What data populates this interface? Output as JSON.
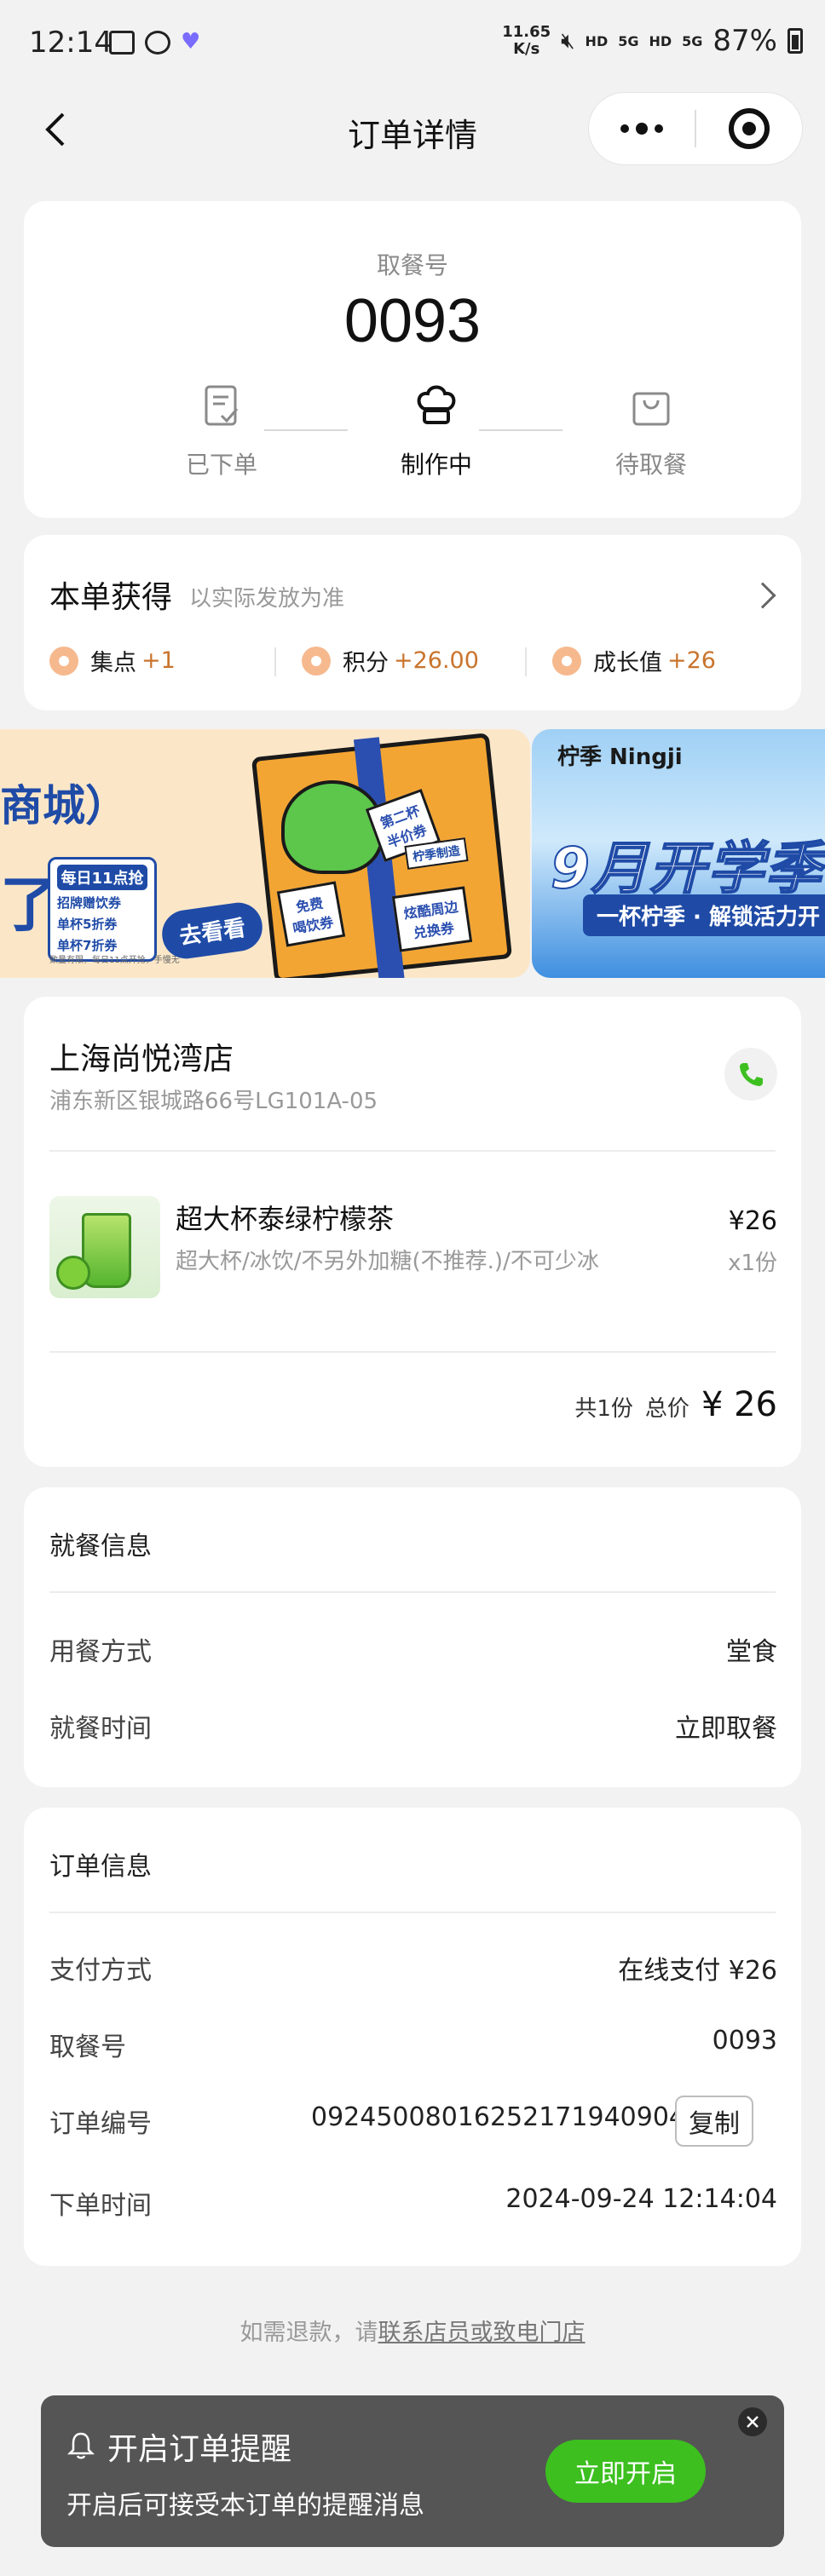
{
  "status_bar": {
    "time": "12:14",
    "net_speed": "11.65",
    "net_unit": "K/s",
    "hd1": "HD",
    "net1": "5G",
    "hd2": "HD",
    "net2": "5G",
    "battery": "87%"
  },
  "nav": {
    "title": "订单详情"
  },
  "pickup": {
    "label": "取餐号",
    "number": "0093",
    "steps": [
      {
        "label": "已下单",
        "icon": "clipboard-check-icon"
      },
      {
        "label": "制作中",
        "icon": "chef-hat-icon"
      },
      {
        "label": "待取餐",
        "icon": "bag-icon"
      }
    ]
  },
  "rewards": {
    "title": "本单获得",
    "subtitle": "以实际发放为准",
    "items": [
      {
        "name": "集点",
        "value": "+1"
      },
      {
        "name": "积分",
        "value": "+26.00"
      },
      {
        "name": "成长值",
        "value": "+26"
      }
    ]
  },
  "banners": {
    "a": {
      "title": "商城）",
      "title2": "了",
      "tag_head": "每日11点抢",
      "tag_lines": [
        "招牌赠饮券",
        "单杯5折券",
        "单杯7折券"
      ],
      "note": "数量有限，每日11点开抢，手慢无",
      "button": "去看看",
      "card1": "免费\n喝饮券",
      "card2": "第二杯\n半价券",
      "card3": "炫酷周边\n兑换券",
      "box_label": "柠季制造"
    },
    "b": {
      "brand": "柠季 Ningji",
      "main": "9月开学季",
      "sub": "一杯柠季 · 解锁活力开"
    }
  },
  "store": {
    "name": "上海尚悦湾店",
    "address": "浦东新区银城路66号LG101A-05",
    "product": {
      "name": "超大杯泰绿柠檬茶",
      "spec": "超大杯/冰饮/不另外加糖(不推荐.)/不可少冰",
      "price": "¥26",
      "qty": "x1份"
    },
    "total_count": "共1份",
    "total_label": "总价",
    "total_value": "¥ 26"
  },
  "dining": {
    "title": "就餐信息",
    "rows": [
      {
        "label": "用餐方式",
        "value": "堂食"
      },
      {
        "label": "就餐时间",
        "value": "立即取餐"
      }
    ]
  },
  "order": {
    "title": "订单信息",
    "rows": [
      {
        "label": "支付方式",
        "value": "在线支付 ¥26"
      },
      {
        "label": "取餐号",
        "value": "0093"
      },
      {
        "label": "订单编号",
        "value": "0924500801625217194 0904"
      },
      {
        "label": "下单时间",
        "value": "2024-09-24 12:14:04"
      }
    ],
    "order_no": "09245008016252171940904",
    "copy_label": "复制"
  },
  "refund": {
    "prefix": "如需退款，请",
    "link": "联系店员或致电门店"
  },
  "reminder": {
    "title": "开启订单提醒",
    "subtitle": "开启后可接受本订单的提醒消息",
    "button": "立即开启"
  }
}
